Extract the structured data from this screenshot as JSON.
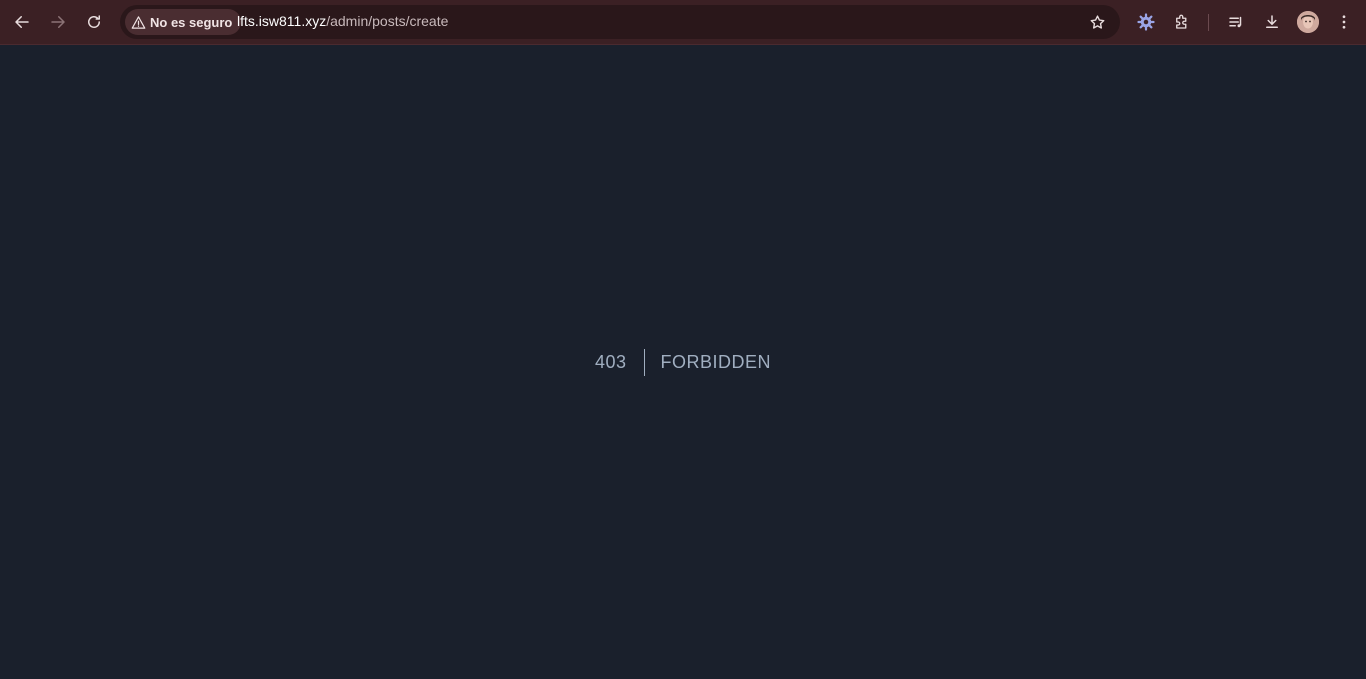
{
  "browser": {
    "security_chip": "No es seguro",
    "url_host": "lfts.isw811.xyz",
    "url_path": "/admin/posts/create"
  },
  "icons": {
    "back": "arrow-left-icon",
    "forward": "arrow-right-icon",
    "reload": "reload-icon",
    "warning": "warning-triangle-icon",
    "bookmark": "star-icon",
    "extension1": "gear-icon",
    "extensions": "puzzle-icon",
    "reading_list": "playlist-icon",
    "downloads": "download-icon",
    "profile": "avatar",
    "menu": "kebab-menu-icon"
  },
  "page": {
    "code": "403",
    "message": "Forbidden"
  },
  "colors": {
    "toolbar": "#3b2024",
    "page_background": "#1a202c",
    "text": "#a0aec0"
  }
}
